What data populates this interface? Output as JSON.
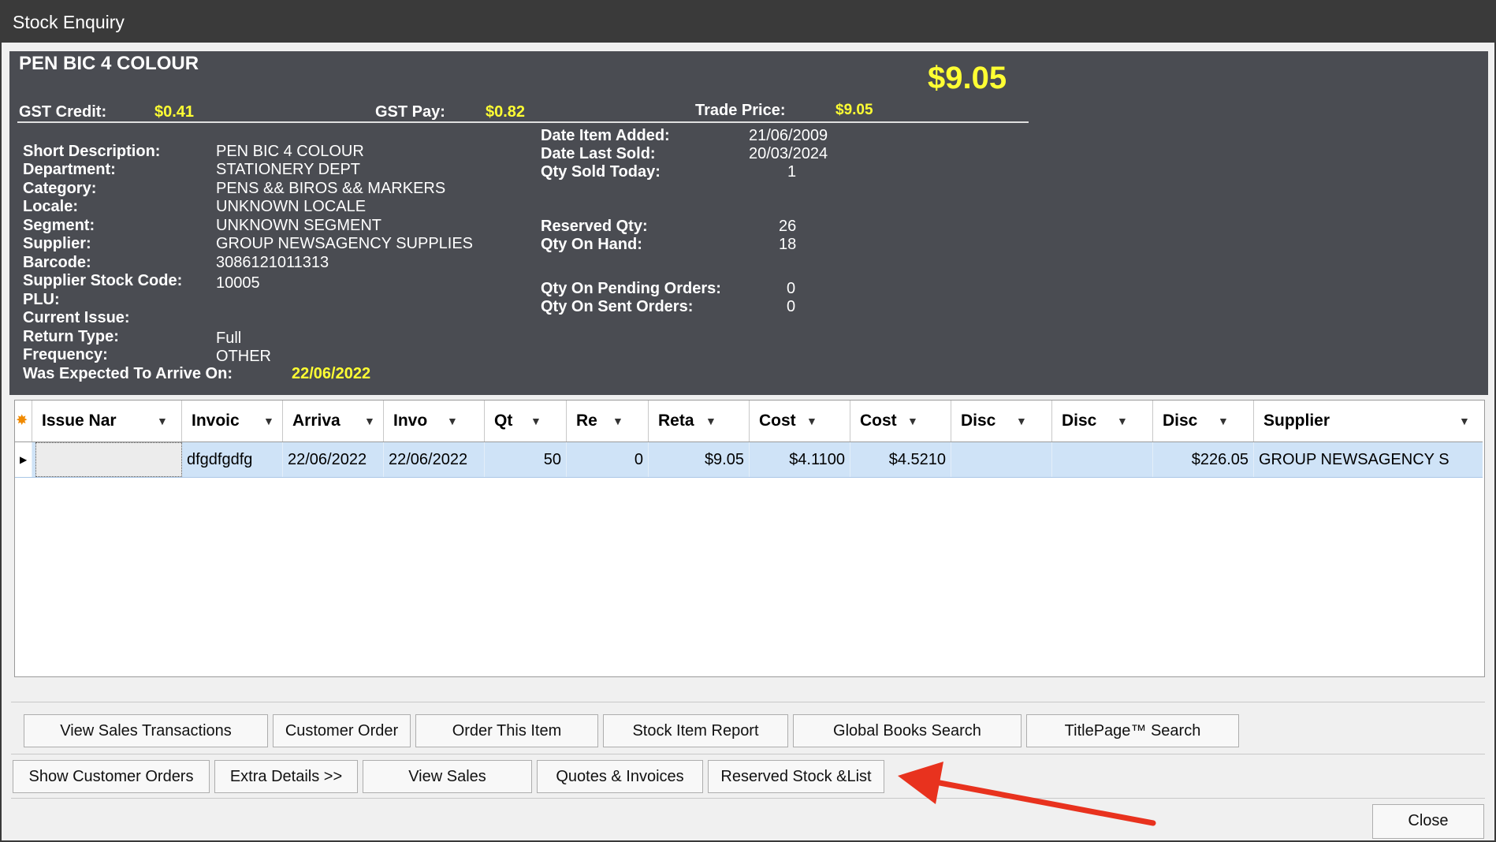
{
  "window": {
    "title": "Stock Enquiry"
  },
  "item": {
    "name": "PEN BIC 4 COLOUR",
    "price": "$9.05",
    "gst_credit_label": "GST Credit:",
    "gst_credit": "$0.41",
    "gst_pay_label": "GST Pay:",
    "gst_pay": "$0.82",
    "trade_price_label": "Trade Price:",
    "trade_price": "$9.05"
  },
  "details_left": [
    {
      "label": "Short Description:",
      "value": "PEN BIC 4 COLOUR"
    },
    {
      "label": "Department:",
      "value": "STATIONERY DEPT"
    },
    {
      "label": "Category:",
      "value": "PENS && BIROS && MARKERS"
    },
    {
      "label": "Locale:",
      "value": "UNKNOWN LOCALE"
    },
    {
      "label": "Segment:",
      "value": "UNKNOWN SEGMENT"
    },
    {
      "label": "Supplier:",
      "value": "GROUP NEWSAGENCY SUPPLIES"
    },
    {
      "label": "Barcode:",
      "value": "3086121011313"
    },
    {
      "label": "Supplier Stock Code:",
      "value": "10005"
    },
    {
      "label": "PLU:",
      "value": ""
    },
    {
      "label": "Current Issue:",
      "value": ""
    },
    {
      "label": "Return Type:",
      "value": "Full"
    },
    {
      "label": "Frequency:",
      "value": "OTHER"
    }
  ],
  "expected": {
    "label": "Was Expected To Arrive On:",
    "value": "22/06/2022"
  },
  "details_right": {
    "date_added_label": "Date Item Added:",
    "date_added": "21/06/2009",
    "date_last_sold_label": "Date Last Sold:",
    "date_last_sold": "20/03/2024",
    "qty_sold_today_label": "Qty Sold Today:",
    "qty_sold_today": "1",
    "reserved_qty_label": "Reserved Qty:",
    "reserved_qty": "26",
    "qty_on_hand_label": "Qty On Hand:",
    "qty_on_hand": "18",
    "qty_pending_label": "Qty On Pending Orders:",
    "qty_pending": "0",
    "qty_sent_label": "Qty On Sent Orders:",
    "qty_sent": "0"
  },
  "grid": {
    "headers": [
      "Issue Nar",
      "Invoic",
      "Arriva",
      "Invo",
      "Qt",
      "Re",
      "Reta",
      "Cost",
      "Cost",
      "Disc",
      "Disc",
      "Disc",
      "Supplier"
    ],
    "row": [
      "",
      "dfgdfgdfg",
      "22/06/2022",
      "22/06/2022",
      "50",
      "0",
      "$9.05",
      "$4.1100",
      "$4.5210",
      "",
      "",
      "$226.05",
      "GROUP NEWSAGENCY S"
    ]
  },
  "buttons_row1": [
    "View Sales Transactions",
    "Customer Order",
    "Order This Item",
    "Stock Item Report",
    "Global Books Search",
    "TitlePage™ Search"
  ],
  "buttons_row2": [
    "Show Customer Orders",
    "Extra Details >>",
    "View Sales",
    "Quotes & Invoices",
    "Reserved Stock &List"
  ],
  "close_button": "Close",
  "colors": {
    "panel": "#4a4c52",
    "highlight": "#ffff33",
    "selected_row": "#cfe3f7",
    "arrow": "#e8321e"
  }
}
